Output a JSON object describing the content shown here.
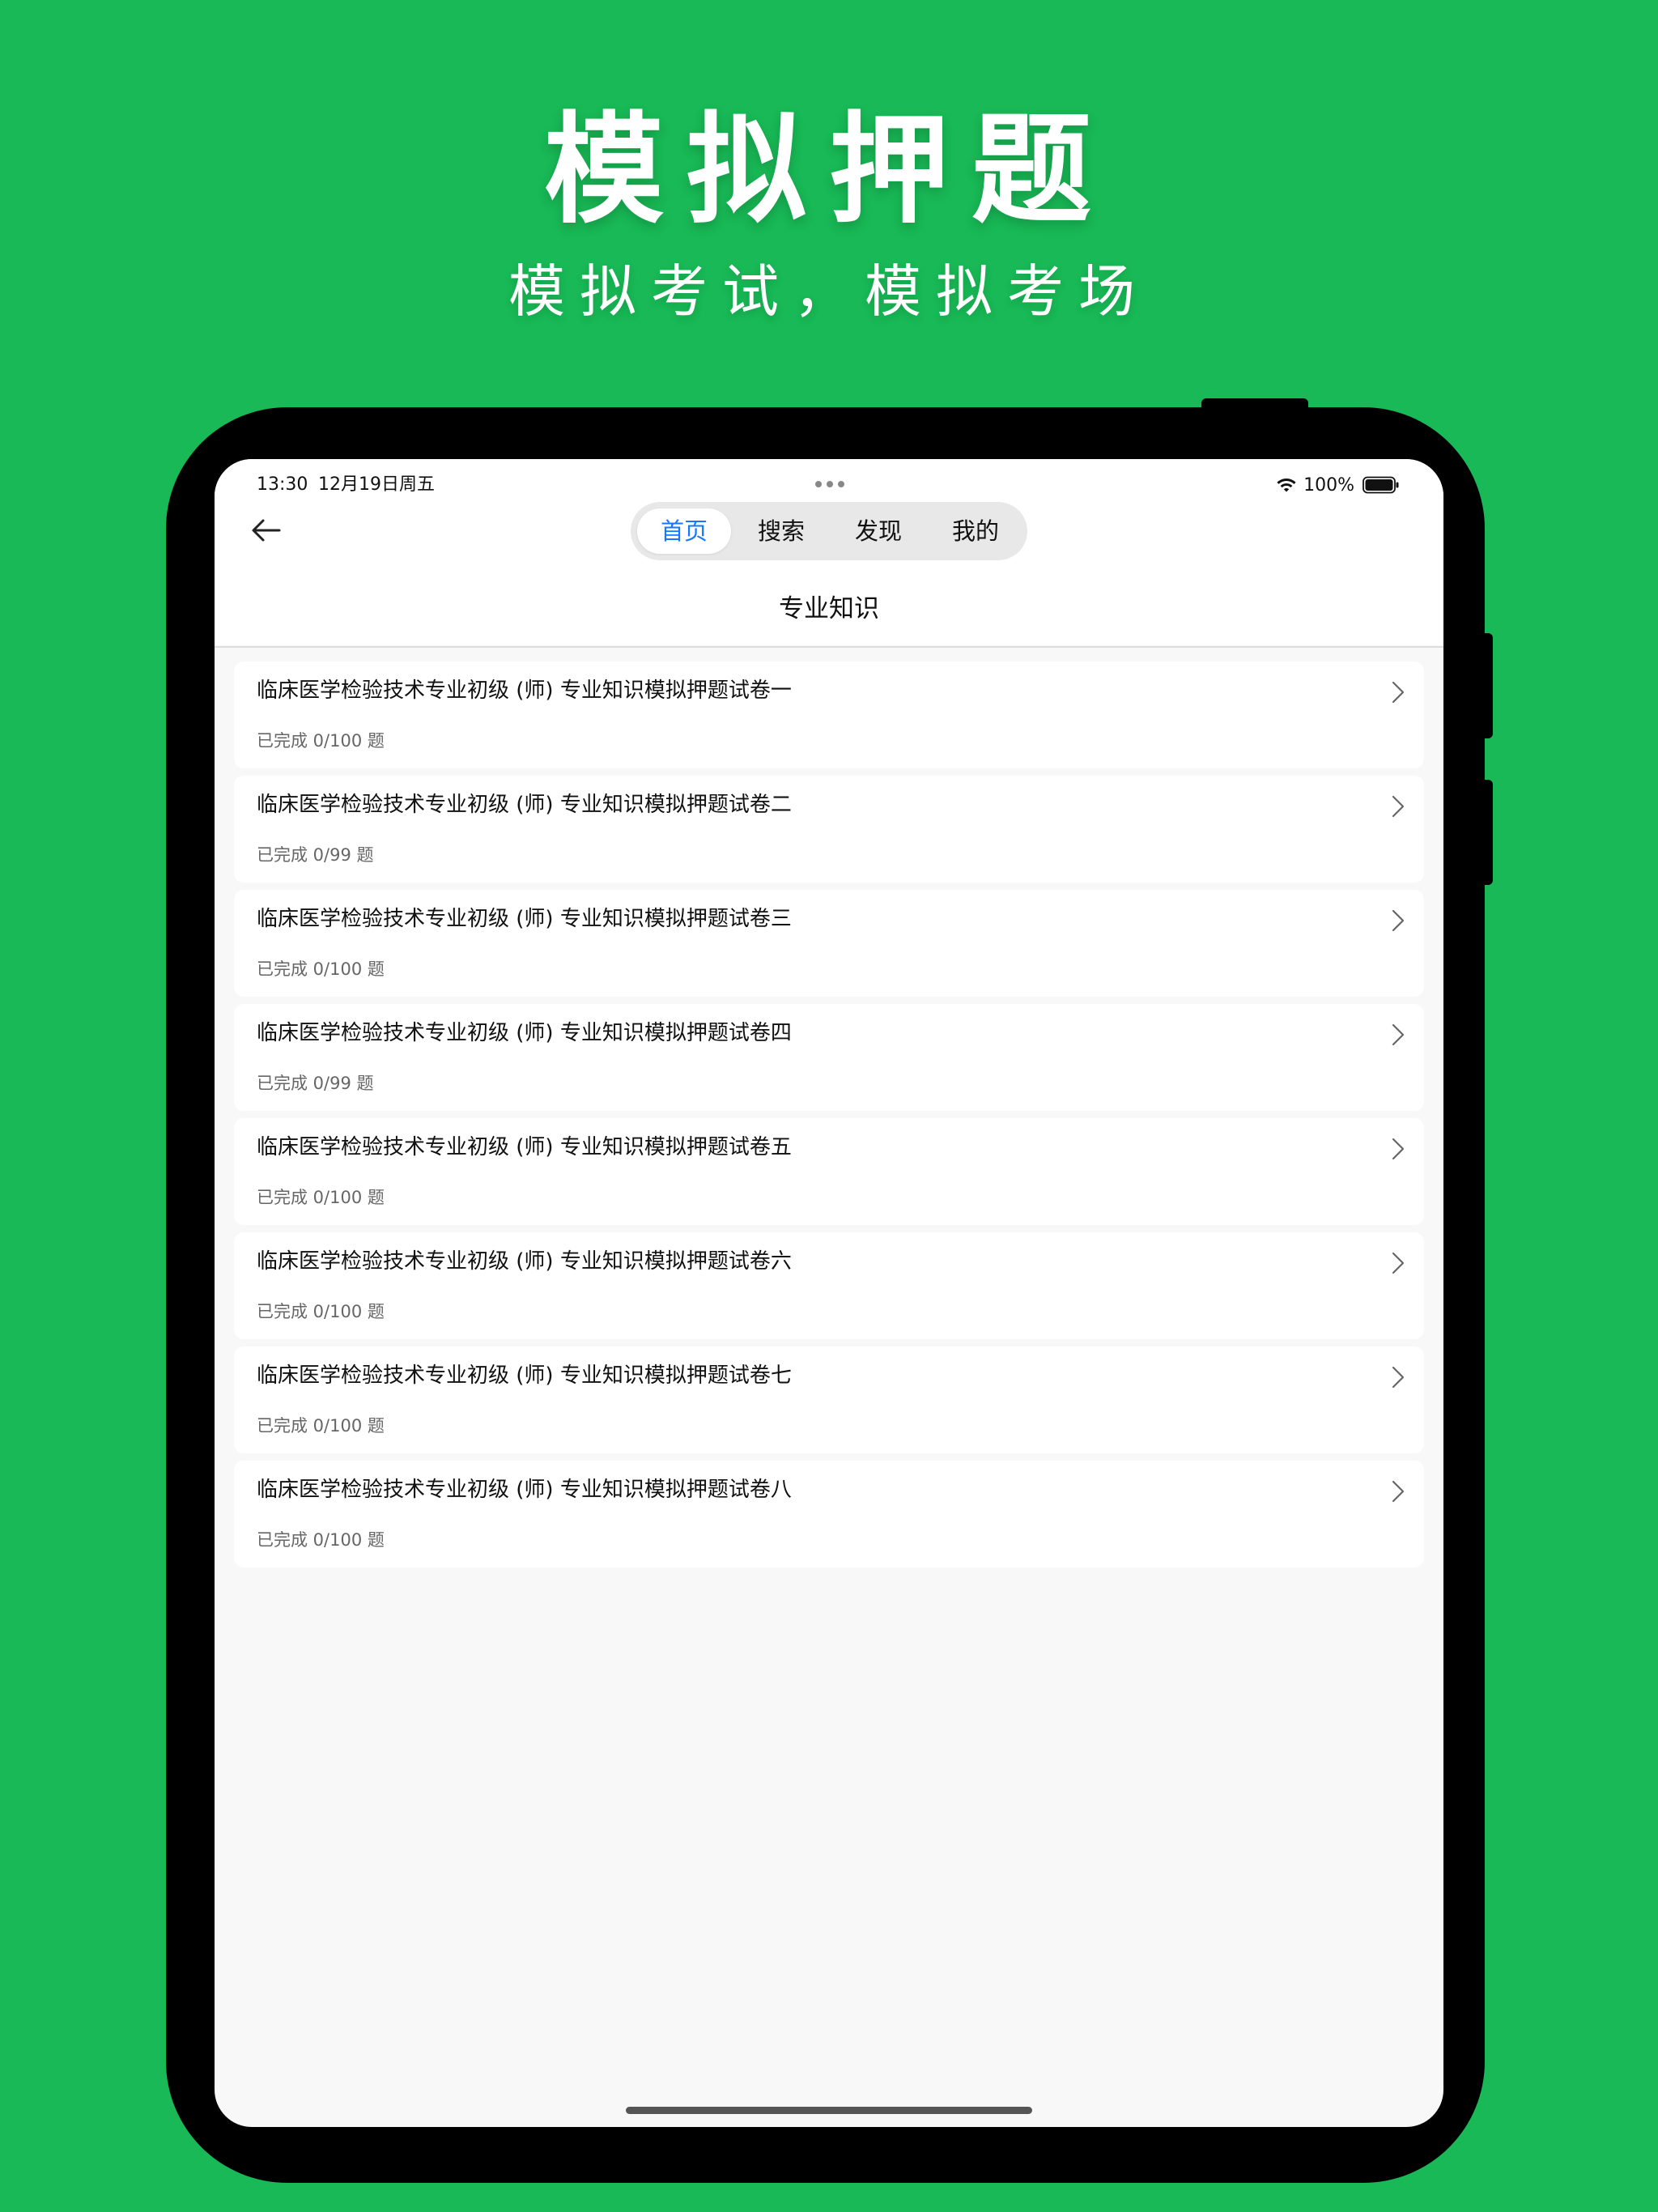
{
  "hero": {
    "title": "模拟押题",
    "subtitle": "模拟考试，模拟考场"
  },
  "status_bar": {
    "time": "13:30",
    "date": "12月19日周五",
    "battery": "100%",
    "icons": [
      "wifi-icon",
      "battery-icon"
    ]
  },
  "nav": {
    "back_icon": "arrow-left-icon",
    "tabs": [
      {
        "label": "首页",
        "active": true
      },
      {
        "label": "搜索",
        "active": false
      },
      {
        "label": "发现",
        "active": false
      },
      {
        "label": "我的",
        "active": false
      }
    ]
  },
  "page": {
    "title": "专业知识"
  },
  "items": [
    {
      "title": "临床医学检验技术专业初级 (师) 专业知识模拟押题试卷一",
      "progress": "已完成 0/100 题"
    },
    {
      "title": "临床医学检验技术专业初级 (师) 专业知识模拟押题试卷二",
      "progress": "已完成 0/99 题"
    },
    {
      "title": "临床医学检验技术专业初级 (师) 专业知识模拟押题试卷三",
      "progress": "已完成 0/100 题"
    },
    {
      "title": "临床医学检验技术专业初级 (师) 专业知识模拟押题试卷四",
      "progress": "已完成 0/99 题"
    },
    {
      "title": "临床医学检验技术专业初级 (师) 专业知识模拟押题试卷五",
      "progress": "已完成 0/100 题"
    },
    {
      "title": "临床医学检验技术专业初级 (师) 专业知识模拟押题试卷六",
      "progress": "已完成 0/100 题"
    },
    {
      "title": "临床医学检验技术专业初级 (师) 专业知识模拟押题试卷七",
      "progress": "已完成 0/100 题"
    },
    {
      "title": "临床医学检验技术专业初级 (师) 专业知识模拟押题试卷八",
      "progress": "已完成 0/100 题"
    }
  ],
  "colors": {
    "background": "#18b956",
    "accent": "#1677ff"
  }
}
